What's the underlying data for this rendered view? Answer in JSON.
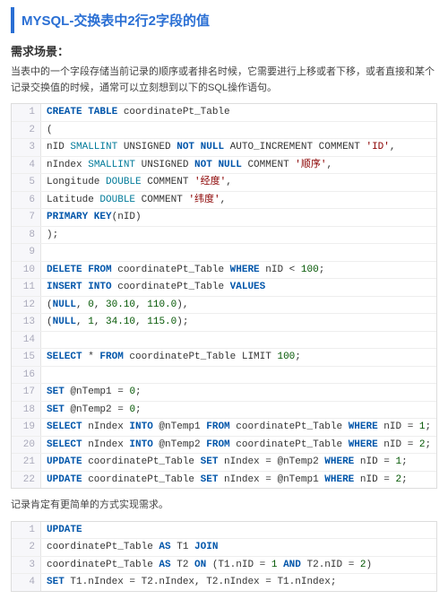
{
  "title": "MYSQL-交换表中2行2字段的值",
  "section_title": "需求场景：",
  "intro": "当表中的一个字段存储当前记录的顺序或者排名时候，它需要进行上移或者下移，或者直接和某个记录交换值的时候，通常可以立刻想到以下的SQL操作语句。",
  "mid_note": "记录肯定有更简单的方式实现需求。",
  "code1": [
    {
      "n": "1",
      "t": [
        [
          "kw",
          "CREATE TABLE"
        ],
        [
          "",
          " coordinatePt_Table"
        ]
      ]
    },
    {
      "n": "2",
      "t": [
        [
          "",
          "("
        ]
      ]
    },
    {
      "n": "3",
      "t": [
        [
          "",
          "nID "
        ],
        [
          "type",
          "SMALLINT"
        ],
        [
          "",
          " UNSIGNED "
        ],
        [
          "kw",
          "NOT NULL"
        ],
        [
          "",
          " AUTO_INCREMENT COMMENT "
        ],
        [
          "str",
          "'ID'"
        ],
        [
          "",
          ","
        ]
      ]
    },
    {
      "n": "4",
      "t": [
        [
          "",
          "nIndex "
        ],
        [
          "type",
          "SMALLINT"
        ],
        [
          "",
          " UNSIGNED "
        ],
        [
          "kw",
          "NOT NULL"
        ],
        [
          "",
          " COMMENT "
        ],
        [
          "str",
          "'顺序'"
        ],
        [
          "",
          ","
        ]
      ]
    },
    {
      "n": "5",
      "t": [
        [
          "",
          "Longitude "
        ],
        [
          "type",
          "DOUBLE"
        ],
        [
          "",
          " COMMENT "
        ],
        [
          "str",
          "'经度'"
        ],
        [
          "",
          ","
        ]
      ]
    },
    {
      "n": "6",
      "t": [
        [
          "",
          "Latitude "
        ],
        [
          "type",
          "DOUBLE"
        ],
        [
          "",
          " COMMENT "
        ],
        [
          "str",
          "'纬度'"
        ],
        [
          "",
          ","
        ]
      ]
    },
    {
      "n": "7",
      "t": [
        [
          "kw",
          "PRIMARY KEY"
        ],
        [
          "",
          "(nID)"
        ]
      ]
    },
    {
      "n": "8",
      "t": [
        [
          "",
          ");"
        ]
      ]
    },
    {
      "n": "9",
      "t": [
        [
          "",
          ""
        ]
      ]
    },
    {
      "n": "10",
      "t": [
        [
          "kw",
          "DELETE FROM"
        ],
        [
          "",
          " coordinatePt_Table "
        ],
        [
          "kw",
          "WHERE"
        ],
        [
          "",
          " nID < "
        ],
        [
          "num",
          "100"
        ],
        [
          "",
          ";"
        ]
      ]
    },
    {
      "n": "11",
      "t": [
        [
          "kw",
          "INSERT INTO"
        ],
        [
          "",
          " coordinatePt_Table "
        ],
        [
          "kw",
          "VALUES"
        ]
      ]
    },
    {
      "n": "12",
      "t": [
        [
          "",
          "("
        ],
        [
          "kw",
          "NULL"
        ],
        [
          "",
          ", "
        ],
        [
          "num",
          "0"
        ],
        [
          "",
          ", "
        ],
        [
          "num",
          "30.10"
        ],
        [
          "",
          ", "
        ],
        [
          "num",
          "110.0"
        ],
        [
          "",
          "),"
        ]
      ]
    },
    {
      "n": "13",
      "t": [
        [
          "",
          "("
        ],
        [
          "kw",
          "NULL"
        ],
        [
          "",
          ", "
        ],
        [
          "num",
          "1"
        ],
        [
          "",
          ", "
        ],
        [
          "num",
          "34.10"
        ],
        [
          "",
          ", "
        ],
        [
          "num",
          "115.0"
        ],
        [
          "",
          ");"
        ]
      ]
    },
    {
      "n": "14",
      "t": [
        [
          "",
          ""
        ]
      ]
    },
    {
      "n": "15",
      "t": [
        [
          "kw",
          "SELECT"
        ],
        [
          "",
          " * "
        ],
        [
          "kw",
          "FROM"
        ],
        [
          "",
          " coordinatePt_Table LIMIT "
        ],
        [
          "num",
          "100"
        ],
        [
          "",
          ";"
        ]
      ]
    },
    {
      "n": "16",
      "t": [
        [
          "",
          ""
        ]
      ]
    },
    {
      "n": "17",
      "t": [
        [
          "kw",
          "SET"
        ],
        [
          "",
          " @nTemp1 = "
        ],
        [
          "num",
          "0"
        ],
        [
          "",
          ";"
        ]
      ]
    },
    {
      "n": "18",
      "t": [
        [
          "kw",
          "SET"
        ],
        [
          "",
          " @nTemp2 = "
        ],
        [
          "num",
          "0"
        ],
        [
          "",
          ";"
        ]
      ]
    },
    {
      "n": "19",
      "t": [
        [
          "kw",
          "SELECT"
        ],
        [
          "",
          " nIndex "
        ],
        [
          "kw",
          "INTO"
        ],
        [
          "",
          " @nTemp1 "
        ],
        [
          "kw",
          "FROM"
        ],
        [
          "",
          " coordinatePt_Table "
        ],
        [
          "kw",
          "WHERE"
        ],
        [
          "",
          " nID = "
        ],
        [
          "num",
          "1"
        ],
        [
          "",
          ";"
        ]
      ]
    },
    {
      "n": "20",
      "t": [
        [
          "kw",
          "SELECT"
        ],
        [
          "",
          " nIndex "
        ],
        [
          "kw",
          "INTO"
        ],
        [
          "",
          " @nTemp2 "
        ],
        [
          "kw",
          "FROM"
        ],
        [
          "",
          " coordinatePt_Table "
        ],
        [
          "kw",
          "WHERE"
        ],
        [
          "",
          " nID = "
        ],
        [
          "num",
          "2"
        ],
        [
          "",
          ";"
        ]
      ]
    },
    {
      "n": "21",
      "t": [
        [
          "kw",
          "UPDATE"
        ],
        [
          "",
          " coordinatePt_Table "
        ],
        [
          "kw",
          "SET"
        ],
        [
          "",
          " nIndex = @nTemp2 "
        ],
        [
          "kw",
          "WHERE"
        ],
        [
          "",
          " nID = "
        ],
        [
          "num",
          "1"
        ],
        [
          "",
          ";"
        ]
      ]
    },
    {
      "n": "22",
      "t": [
        [
          "kw",
          "UPDATE"
        ],
        [
          "",
          " coordinatePt_Table "
        ],
        [
          "kw",
          "SET"
        ],
        [
          "",
          " nIndex = @nTemp1 "
        ],
        [
          "kw",
          "WHERE"
        ],
        [
          "",
          " nID = "
        ],
        [
          "num",
          "2"
        ],
        [
          "",
          ";"
        ]
      ]
    }
  ],
  "code2": [
    {
      "n": "1",
      "t": [
        [
          "kw",
          "UPDATE"
        ]
      ]
    },
    {
      "n": "2",
      "t": [
        [
          "",
          "coordinatePt_Table "
        ],
        [
          "kw",
          "AS"
        ],
        [
          "",
          " T1 "
        ],
        [
          "kw",
          "JOIN"
        ]
      ]
    },
    {
      "n": "3",
      "t": [
        [
          "",
          "coordinatePt_Table "
        ],
        [
          "kw",
          "AS"
        ],
        [
          "",
          " T2 "
        ],
        [
          "kw",
          "ON"
        ],
        [
          "",
          " (T1.nID = "
        ],
        [
          "num",
          "1"
        ],
        [
          "",
          " "
        ],
        [
          "kw",
          "AND"
        ],
        [
          "",
          " T2.nID = "
        ],
        [
          "num",
          "2"
        ],
        [
          "",
          ")"
        ]
      ]
    },
    {
      "n": "4",
      "t": [
        [
          "kw",
          "SET"
        ],
        [
          "",
          " T1.nIndex = T2.nIndex, T2.nIndex = T1.nIndex;"
        ]
      ]
    }
  ]
}
